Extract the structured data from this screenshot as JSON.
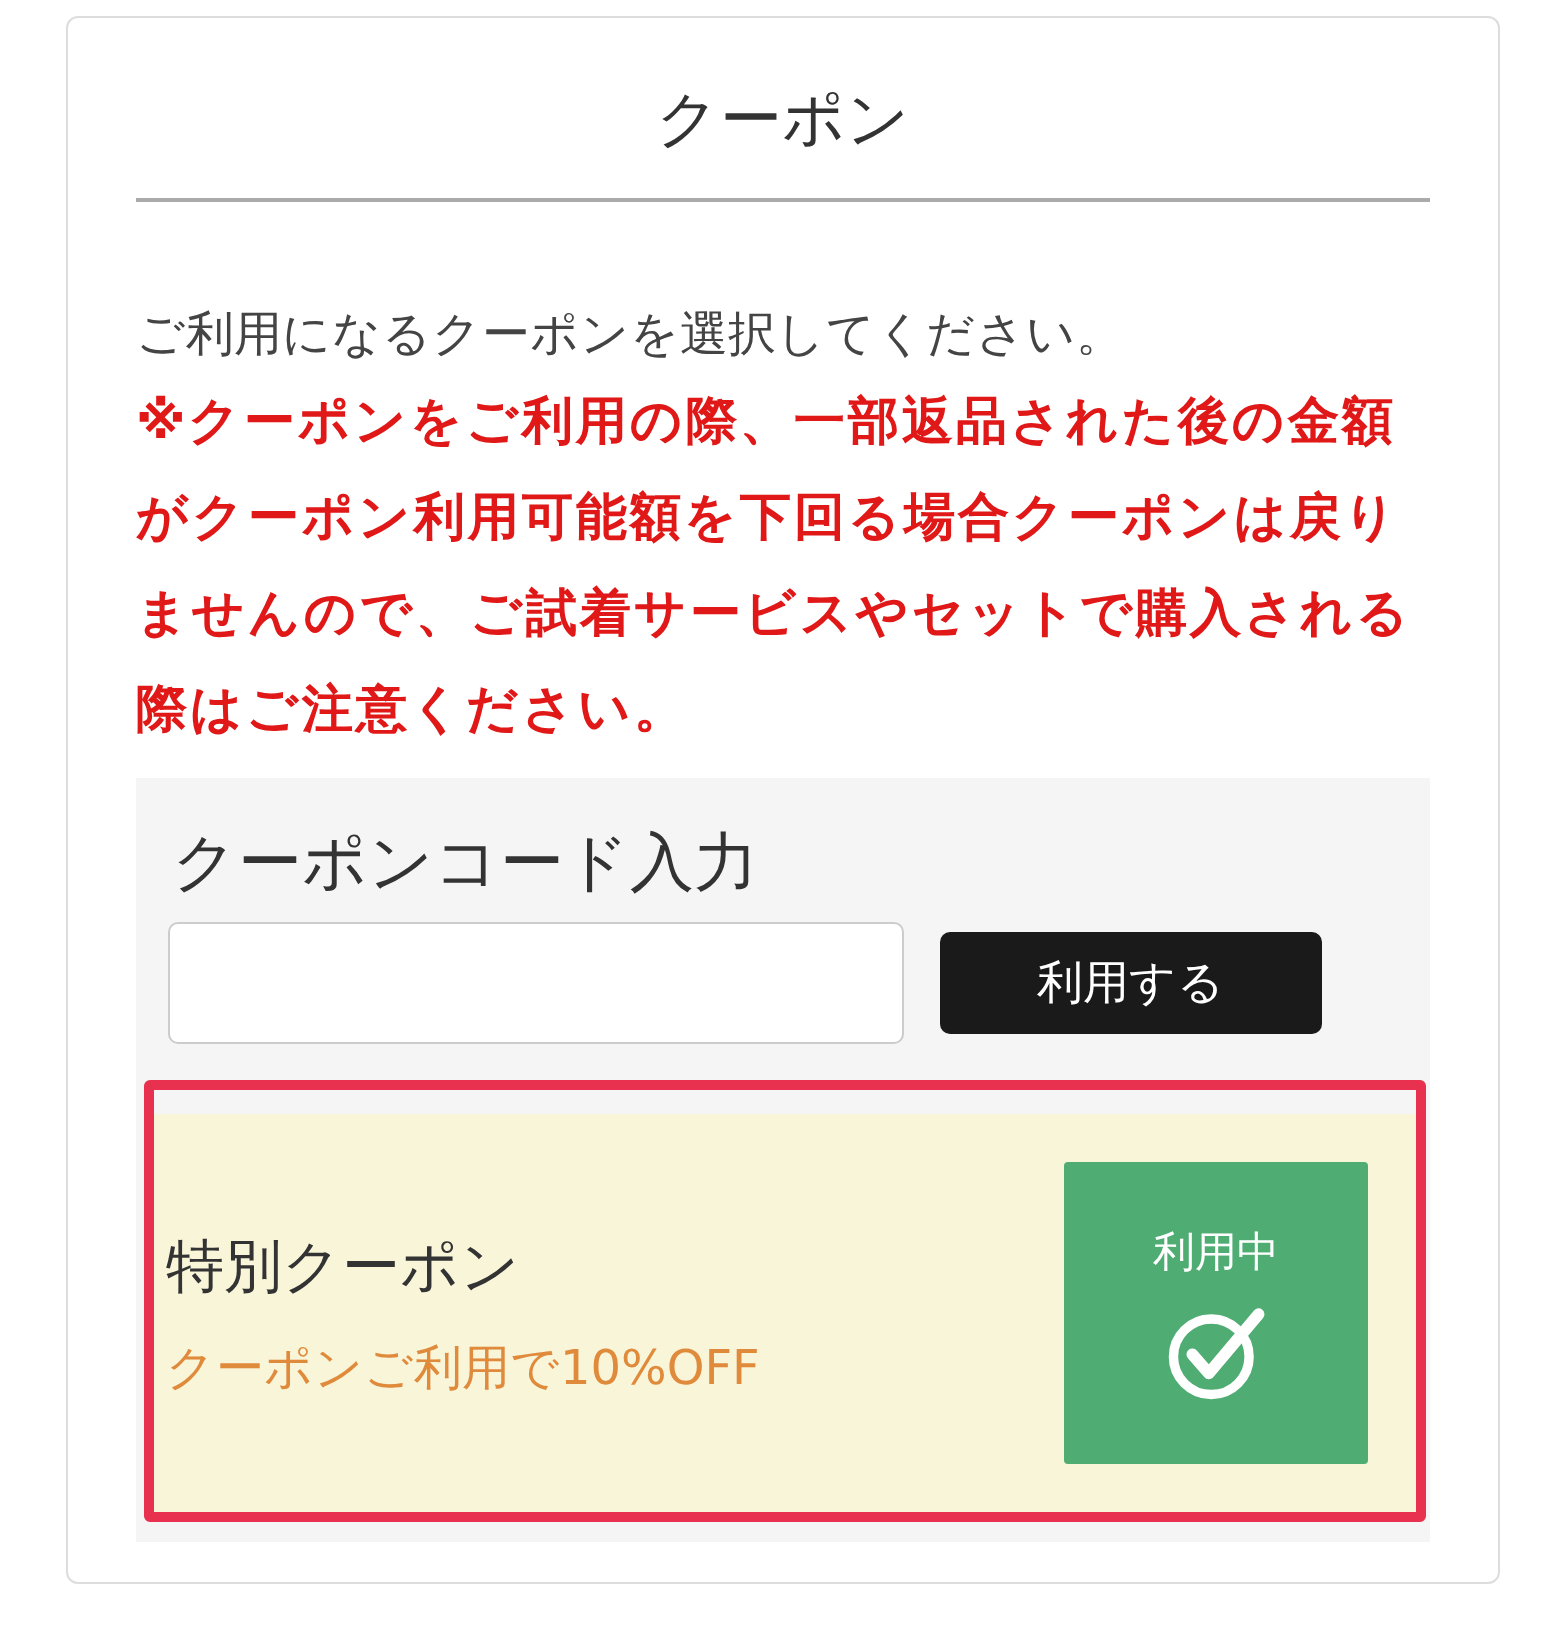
{
  "title": "クーポン",
  "instruction": "ご利用になるクーポンを選択してください。",
  "warning": "※クーポンをご利用の際、一部返品された後の金額がクーポン利用可能額を下回る場合クーポンは戻りませんので、ご試着サービスやセットで購入される際はご注意ください。",
  "code_entry": {
    "heading": "クーポンコード入力",
    "button": "利用する"
  },
  "coupons": [
    {
      "name": "特別クーポン",
      "description": "クーポンご利用で10%OFF",
      "status": "利用中",
      "selected": true,
      "highlighted": true
    }
  ]
}
